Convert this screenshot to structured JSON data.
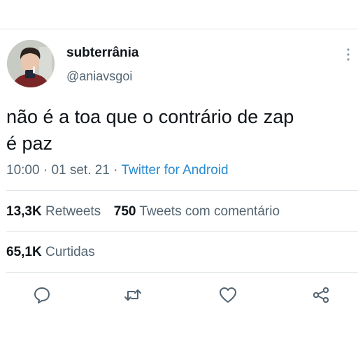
{
  "author": {
    "display_name": "subterrânia",
    "handle": "@aniavsgoi"
  },
  "tweet": {
    "text_line1": "não é a toa que o contrário de zap",
    "text_line2": "é paz"
  },
  "meta": {
    "time": "10:00",
    "sep1": " · ",
    "date": "01 set. 21",
    "sep2": " · ",
    "source": "Twitter for Android"
  },
  "stats": {
    "retweets_count": "13,3K",
    "retweets_label": "Retweets",
    "quotes_count": "750",
    "quotes_label": "Tweets com comentário",
    "likes_count": "65,1K",
    "likes_label": "Curtidas"
  },
  "actions": {
    "reply_icon": "reply-icon",
    "retweet_icon": "retweet-icon",
    "like_icon": "heart-icon",
    "share_icon": "share-icon"
  },
  "colors": {
    "text": "#0f1419",
    "secondary": "#536471",
    "link": "#2a8bd2",
    "divider": "#e1e6ea"
  }
}
